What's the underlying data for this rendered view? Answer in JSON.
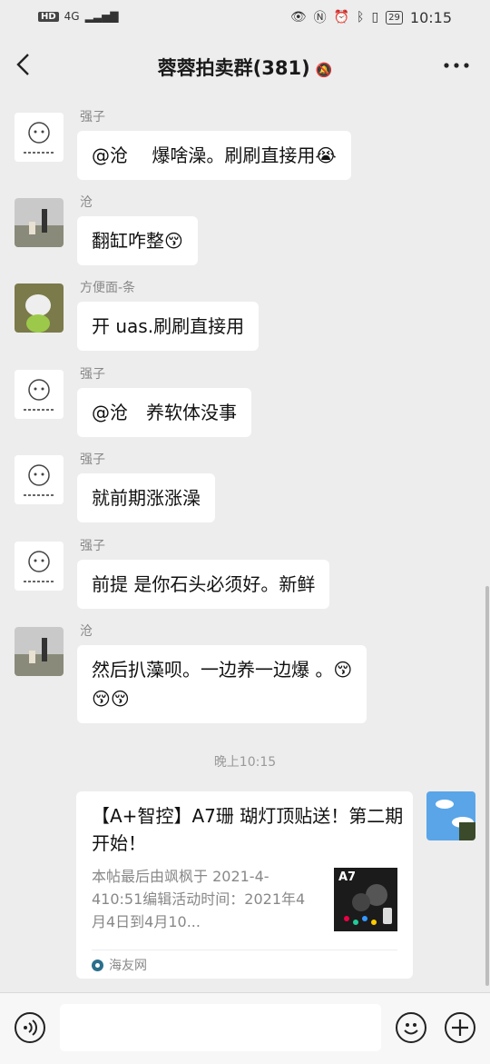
{
  "status_bar": {
    "hd": "HD",
    "network": "4G",
    "time": "10:15",
    "battery": "29"
  },
  "header": {
    "title": "蓉蓉拍卖群(381)"
  },
  "messages": [
    {
      "nick": "强子",
      "text": "@沧　 爆啥澡。刷刷直接用😭"
    },
    {
      "nick": "沧",
      "text": "翻缸咋整😚"
    },
    {
      "nick": "方便面-条",
      "text": "开 uas.刷刷直接用"
    },
    {
      "nick": "强子",
      "text": "@沧　养软体没事"
    },
    {
      "nick": "强子",
      "text": "就前期涨涨澡"
    },
    {
      "nick": "强子",
      "text": "前提 是你石头必须好。新鲜"
    },
    {
      "nick": "沧",
      "line1": "然后扒藻呗。一边养一边爆 。😚",
      "line2": "😚😚"
    }
  ],
  "timestamp": "晚上10:15",
  "card": {
    "title": "【A+智控】A7珊 瑚灯顶贴送！第二期开始！",
    "desc": "本帖最后由飒枫于 2021-4-410:51编辑活动时间：2021年4月4日到4月10...",
    "thumb_label": "A7",
    "source": "海友网"
  },
  "icons": {
    "back": "back-arrow-icon",
    "more": "more-icon",
    "mute": "mute-bell-icon",
    "voice": "voice-icon",
    "emoji": "emoji-icon",
    "add": "add-icon"
  }
}
